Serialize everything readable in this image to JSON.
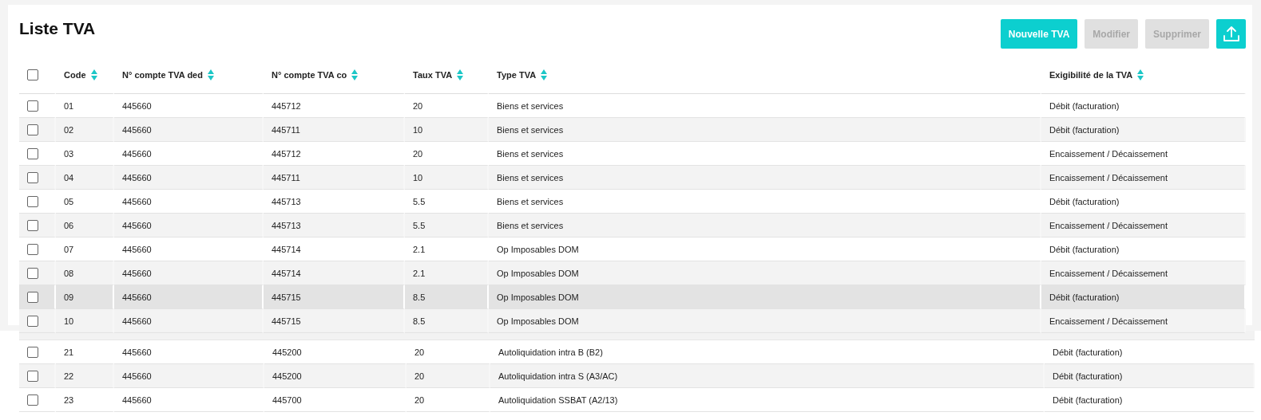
{
  "title": "Liste TVA",
  "buttons": [
    {
      "kind": "primary",
      "label": "Nouvelle TVA",
      "disabled": false
    },
    {
      "kind": "text",
      "label": "Modifier",
      "disabled": true
    },
    {
      "kind": "text",
      "label": "Supprimer",
      "disabled": true
    },
    {
      "kind": "upload",
      "disabled": false
    }
  ],
  "table": {
    "select_all_checked": false,
    "columns": [
      "Code",
      "N° compte TVA ded",
      "N° compte TVA co",
      "Taux TVA",
      "Type TVA",
      "Exigibilité de la TVA"
    ],
    "rows": [
      {
        "checked": false,
        "hovered": false,
        "cells": [
          "01",
          "445660",
          "445712",
          "20",
          "Biens et services",
          "Débit (facturation)"
        ]
      },
      {
        "checked": false,
        "hovered": false,
        "cells": [
          "02",
          "445660",
          "445711",
          "10",
          "Biens et services",
          "Débit (facturation)"
        ]
      },
      {
        "checked": false,
        "hovered": false,
        "cells": [
          "03",
          "445660",
          "445712",
          "20",
          "Biens et services",
          "Encaissement / Décaissement"
        ]
      },
      {
        "checked": false,
        "hovered": false,
        "cells": [
          "04",
          "445660",
          "445711",
          "10",
          "Biens et services",
          "Encaissement / Décaissement"
        ]
      },
      {
        "checked": false,
        "hovered": false,
        "cells": [
          "05",
          "445660",
          "445713",
          "5.5",
          "Biens et services",
          "Débit (facturation)"
        ]
      },
      {
        "checked": false,
        "hovered": false,
        "cells": [
          "06",
          "445660",
          "445713",
          "5.5",
          "Biens et services",
          "Encaissement / Décaissement"
        ]
      },
      {
        "checked": false,
        "hovered": false,
        "cells": [
          "07",
          "445660",
          "445714",
          "2.1",
          "Op Imposables DOM",
          "Débit (facturation)"
        ]
      },
      {
        "checked": false,
        "hovered": false,
        "cells": [
          "08",
          "445660",
          "445714",
          "2.1",
          "Op Imposables DOM",
          "Encaissement / Décaissement"
        ]
      },
      {
        "checked": false,
        "hovered": true,
        "cells": [
          "09",
          "445660",
          "445715",
          "8.5",
          "Op Imposables DOM",
          "Débit (facturation)"
        ]
      },
      {
        "checked": false,
        "hovered": false,
        "cells": [
          "10",
          "445660",
          "445715",
          "8.5",
          "Op Imposables DOM",
          "Encaissement / Décaissement"
        ]
      }
    ]
  },
  "table_2": {
    "rows": [
      {
        "checked": false,
        "hovered": false,
        "cells": [
          "21",
          "445660",
          "445200",
          "20",
          "Autoliquidation intra B (B2)",
          "Débit (facturation)"
        ]
      },
      {
        "checked": false,
        "hovered": false,
        "cells": [
          "22",
          "445660",
          "445200",
          "20",
          "Autoliquidation intra S (A3/AC)",
          "Débit (facturation)"
        ]
      },
      {
        "checked": false,
        "hovered": false,
        "cells": [
          "23",
          "445660",
          "445700",
          "20",
          "Autoliquidation SSBAT (A2/13)",
          "Débit (facturation)"
        ]
      }
    ]
  }
}
